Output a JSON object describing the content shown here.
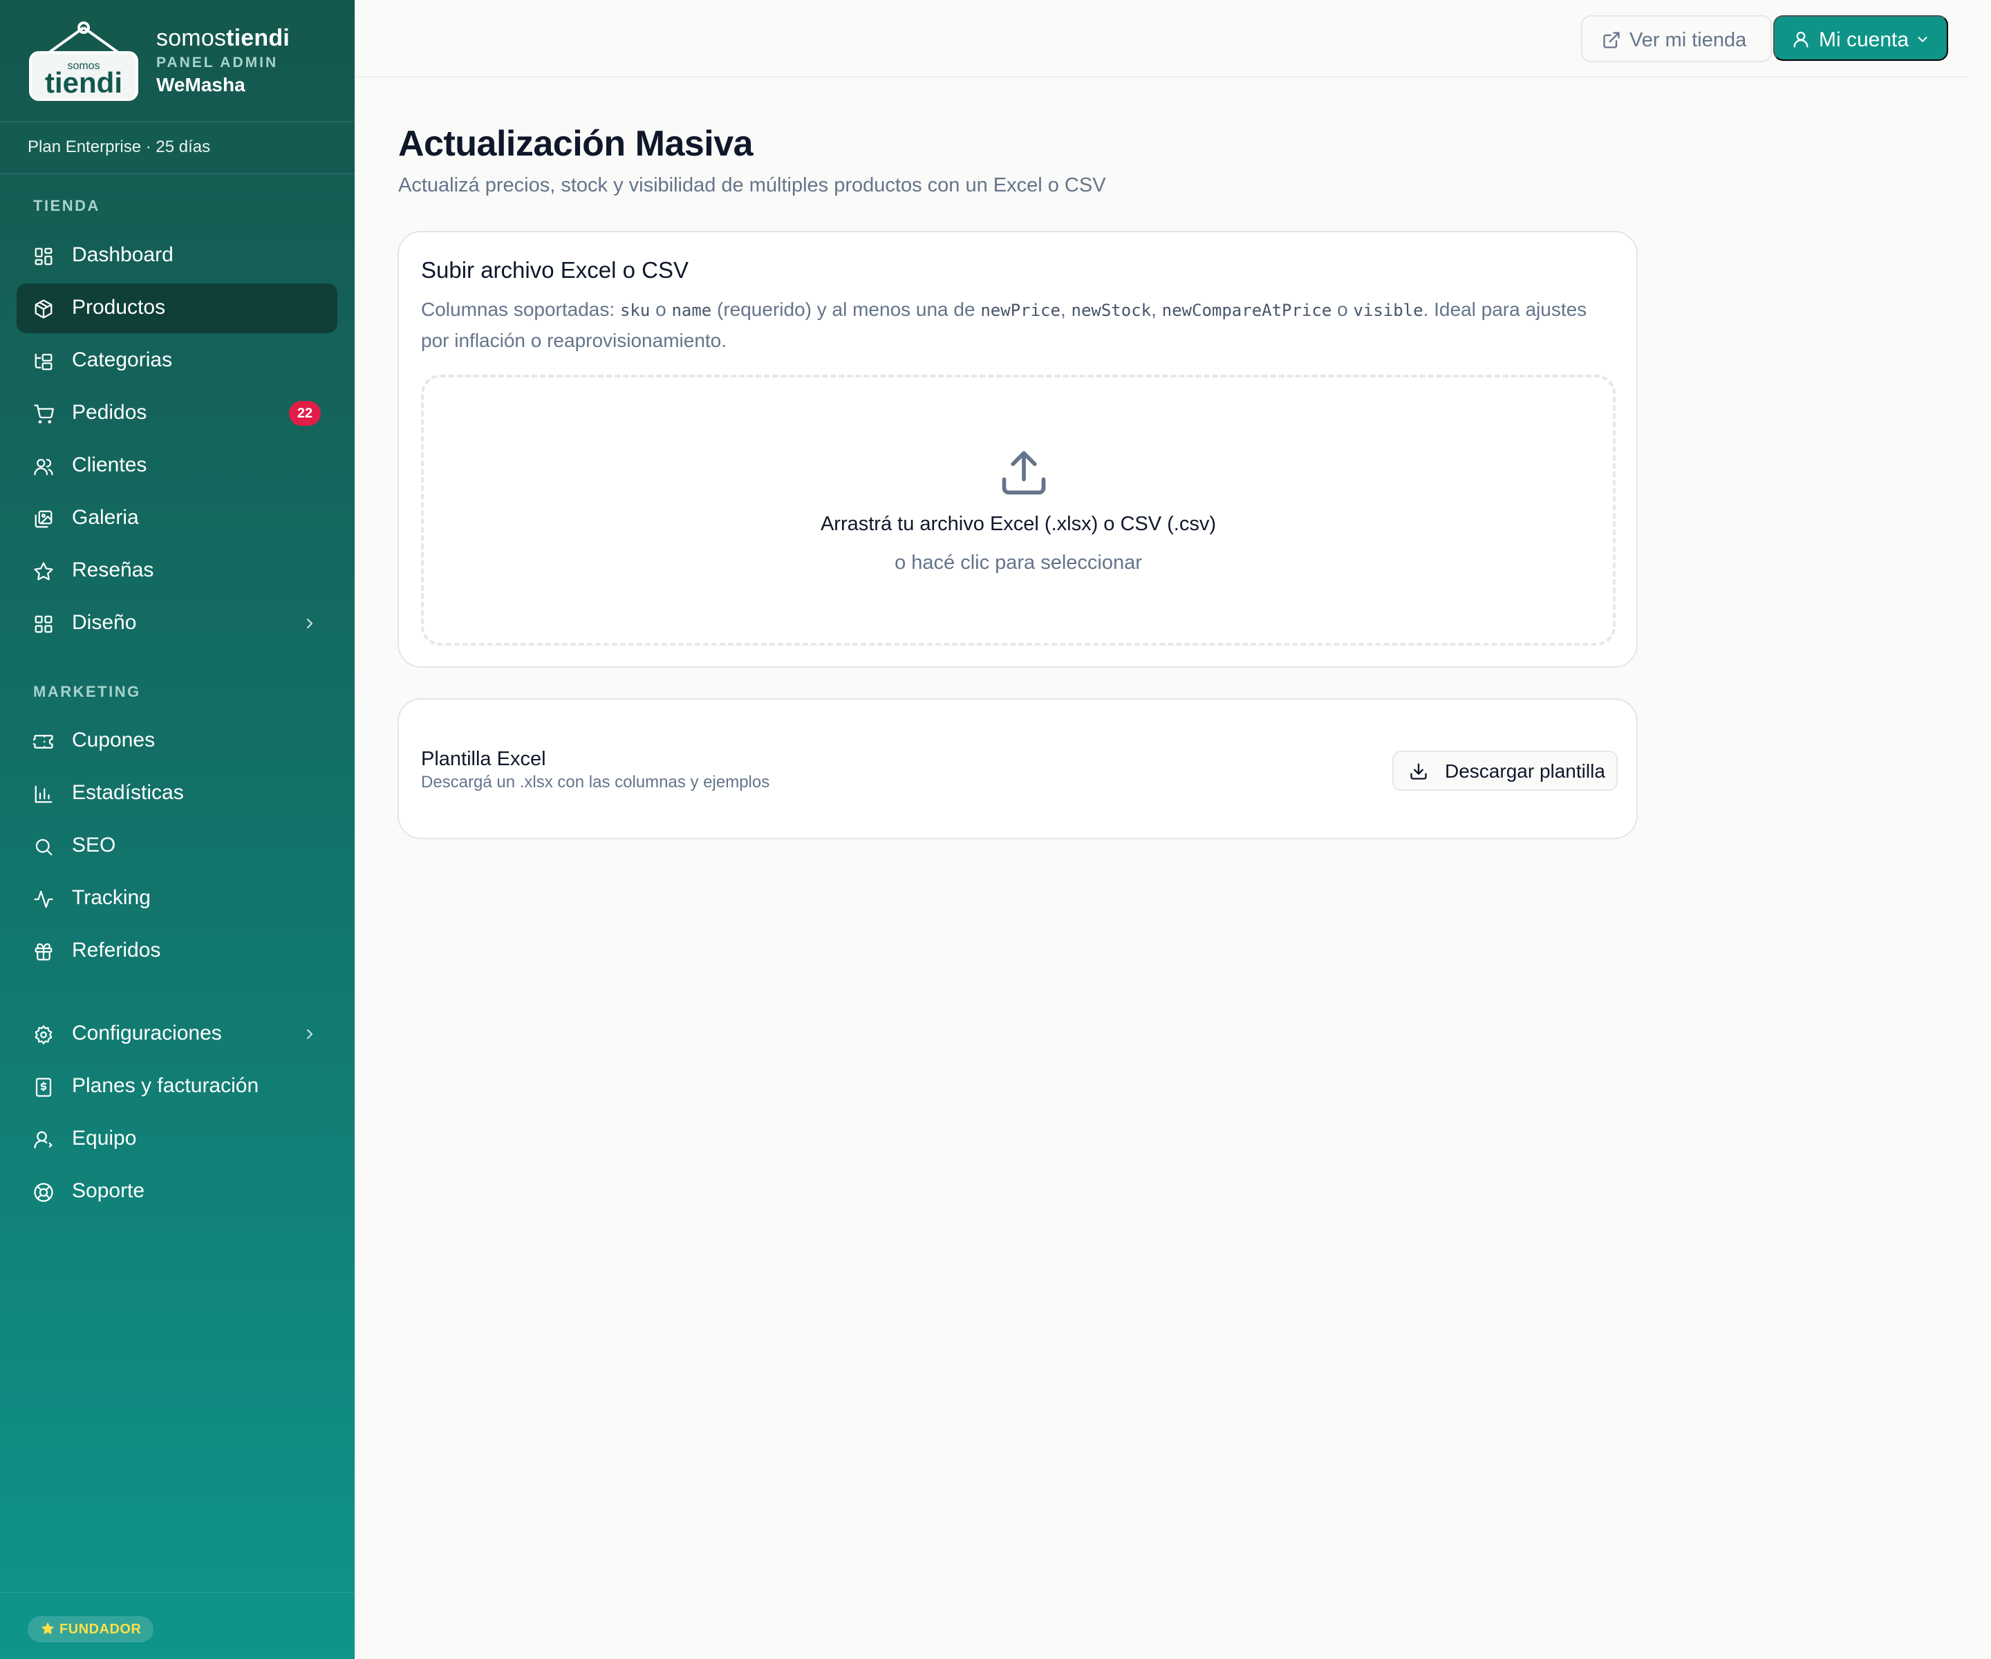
{
  "brand": {
    "logo_text_small": "somos",
    "logo_text_big": "tiendi",
    "name_light": "somos",
    "name_bold": "tiendi",
    "subtitle": "PANEL ADMIN",
    "store": "WeMasha"
  },
  "plan": {
    "text": "Plan Enterprise · 25 días"
  },
  "sidebar": {
    "sections": {
      "tienda": "TIENDA",
      "marketing": "MARKETING"
    },
    "items": {
      "dashboard": {
        "label": "Dashboard",
        "icon": "layout-grid-icon"
      },
      "productos": {
        "label": "Productos",
        "icon": "package-icon",
        "active": true
      },
      "categorias": {
        "label": "Categorias",
        "icon": "folder-tree-icon"
      },
      "pedidos": {
        "label": "Pedidos",
        "icon": "shopping-cart-icon",
        "badge": "22"
      },
      "clientes": {
        "label": "Clientes",
        "icon": "users-icon"
      },
      "galeria": {
        "label": "Galeria",
        "icon": "images-icon"
      },
      "resenas": {
        "label": "Reseñas",
        "icon": "star-icon"
      },
      "diseno": {
        "label": "Diseño",
        "icon": "layout-grid-icon"
      },
      "cupones": {
        "label": "Cupones",
        "icon": "ticket-icon"
      },
      "estadisticas": {
        "label": "Estadísticas",
        "icon": "bar-chart-icon"
      },
      "seo": {
        "label": "SEO",
        "icon": "search-icon"
      },
      "tracking": {
        "label": "Tracking",
        "icon": "activity-icon"
      },
      "referidos": {
        "label": "Referidos",
        "icon": "gift-icon"
      },
      "configuraciones": {
        "label": "Configuraciones",
        "icon": "gear-icon"
      },
      "planes": {
        "label": "Planes y facturación",
        "icon": "receipt-icon"
      },
      "equipo": {
        "label": "Equipo",
        "icon": "user-icon"
      },
      "soporte": {
        "label": "Soporte",
        "icon": "life-buoy-icon"
      }
    },
    "footer_badge": "FUNDADOR"
  },
  "topbar": {
    "store_button": "Ver mi tienda",
    "account_button": "Mi cuenta"
  },
  "page": {
    "title": "Actualización Masiva",
    "subtitle": "Actualizá precios, stock y visibilidad de múltiples productos con un Excel o CSV"
  },
  "upload_card": {
    "title": "Subir archivo Excel o CSV",
    "desc": {
      "t1": "Columnas soportadas: ",
      "c1": "sku",
      "t2": " o ",
      "c2": "name",
      "t3": " (requerido) y al menos una de ",
      "c3": "newPrice",
      "t4": ", ",
      "c4": "newStock",
      "t5": ", ",
      "c5": "newCompareAtPrice",
      "t6": " o ",
      "c6": "visible",
      "t7": ". Ideal para ajustes por inflación o reaprovisionamiento."
    },
    "dropzone_main": "Arrastrá tu archivo Excel (.xlsx) o CSV (.csv)",
    "dropzone_sub": "o hacé clic para seleccionar"
  },
  "template_card": {
    "title": "Plantilla Excel",
    "subtitle": "Descargá un .xlsx con las columnas y ejemplos",
    "button": "Descargar plantilla"
  },
  "colors": {
    "accent": "#0f9488",
    "sidebar_top": "#14574d",
    "sidebar_bottom": "#0f958a",
    "badge": "#e11d48",
    "founder": "#fde047"
  }
}
